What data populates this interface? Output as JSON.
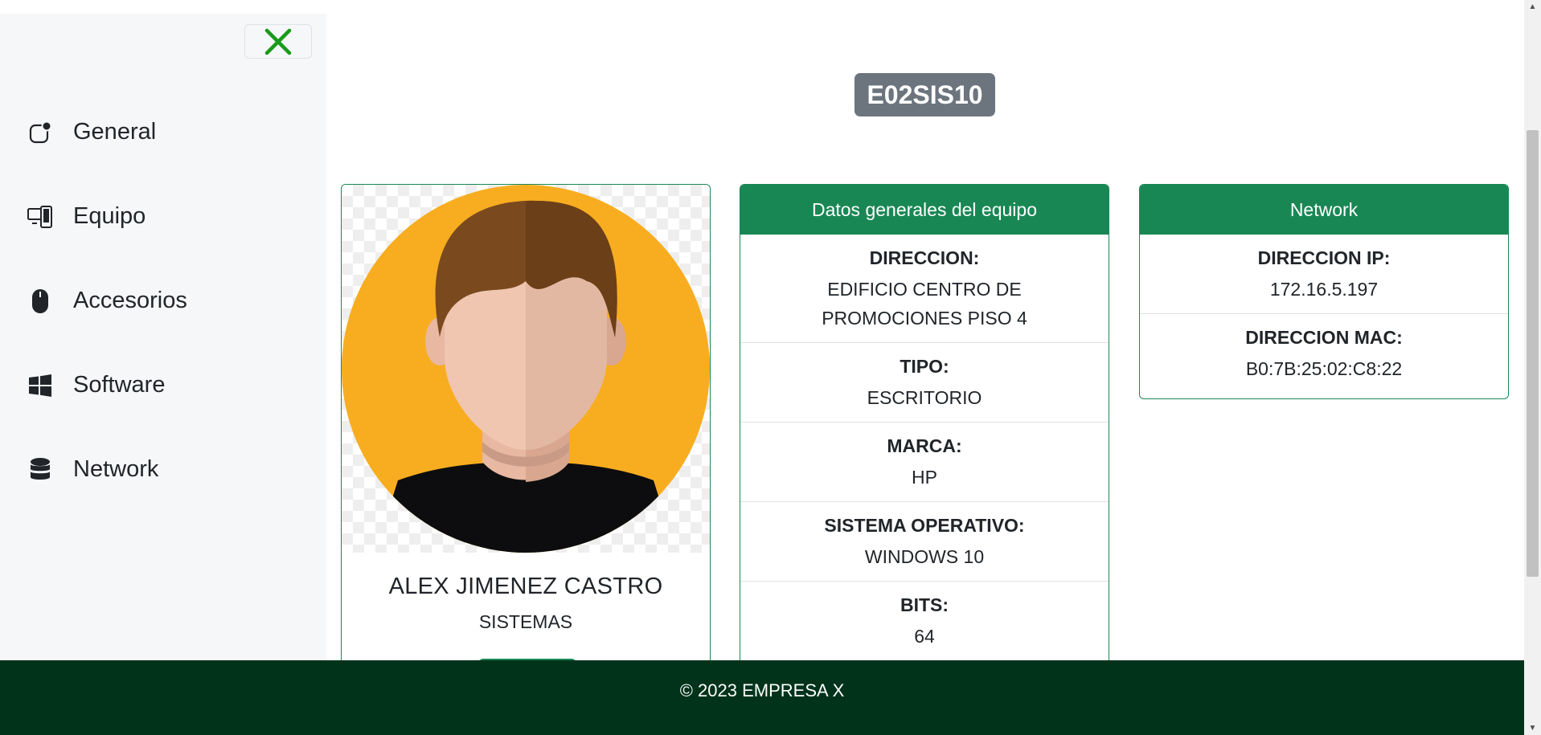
{
  "sidebar": {
    "close_icon": "x-icon",
    "items": [
      {
        "label": "General",
        "icon": "general-icon"
      },
      {
        "label": "Equipo",
        "icon": "devices-icon"
      },
      {
        "label": "Accesorios",
        "icon": "mouse-icon"
      },
      {
        "label": "Software",
        "icon": "windows-icon"
      },
      {
        "label": "Network",
        "icon": "database-icon"
      }
    ]
  },
  "header": {
    "hostname": "E02SIS10"
  },
  "user_card": {
    "name": "ALEX JIMENEZ CASTRO",
    "department": "SISTEMAS"
  },
  "general_card": {
    "title": "Datos generales del equipo",
    "fields": [
      {
        "label": "DIRECCION:",
        "value": "EDIFICIO CENTRO DE PROMOCIONES PISO 4"
      },
      {
        "label": "TIPO:",
        "value": "ESCRITORIO"
      },
      {
        "label": "MARCA:",
        "value": "HP"
      },
      {
        "label": "SISTEMA OPERATIVO:",
        "value": "WINDOWS 10"
      },
      {
        "label": "BITS:",
        "value": "64"
      }
    ]
  },
  "network_card": {
    "title": "Network",
    "fields": [
      {
        "label": "DIRECCION IP:",
        "value": "172.16.5.197"
      },
      {
        "label": "DIRECCION MAC:",
        "value": "B0:7B:25:02:C8:22"
      }
    ]
  },
  "footer": {
    "text": "© 2023 EMPRESA X"
  },
  "colors": {
    "accent": "#198754",
    "footer": "#00331a",
    "badge": "#6c757d",
    "close_icon": "#1a9a1a"
  }
}
